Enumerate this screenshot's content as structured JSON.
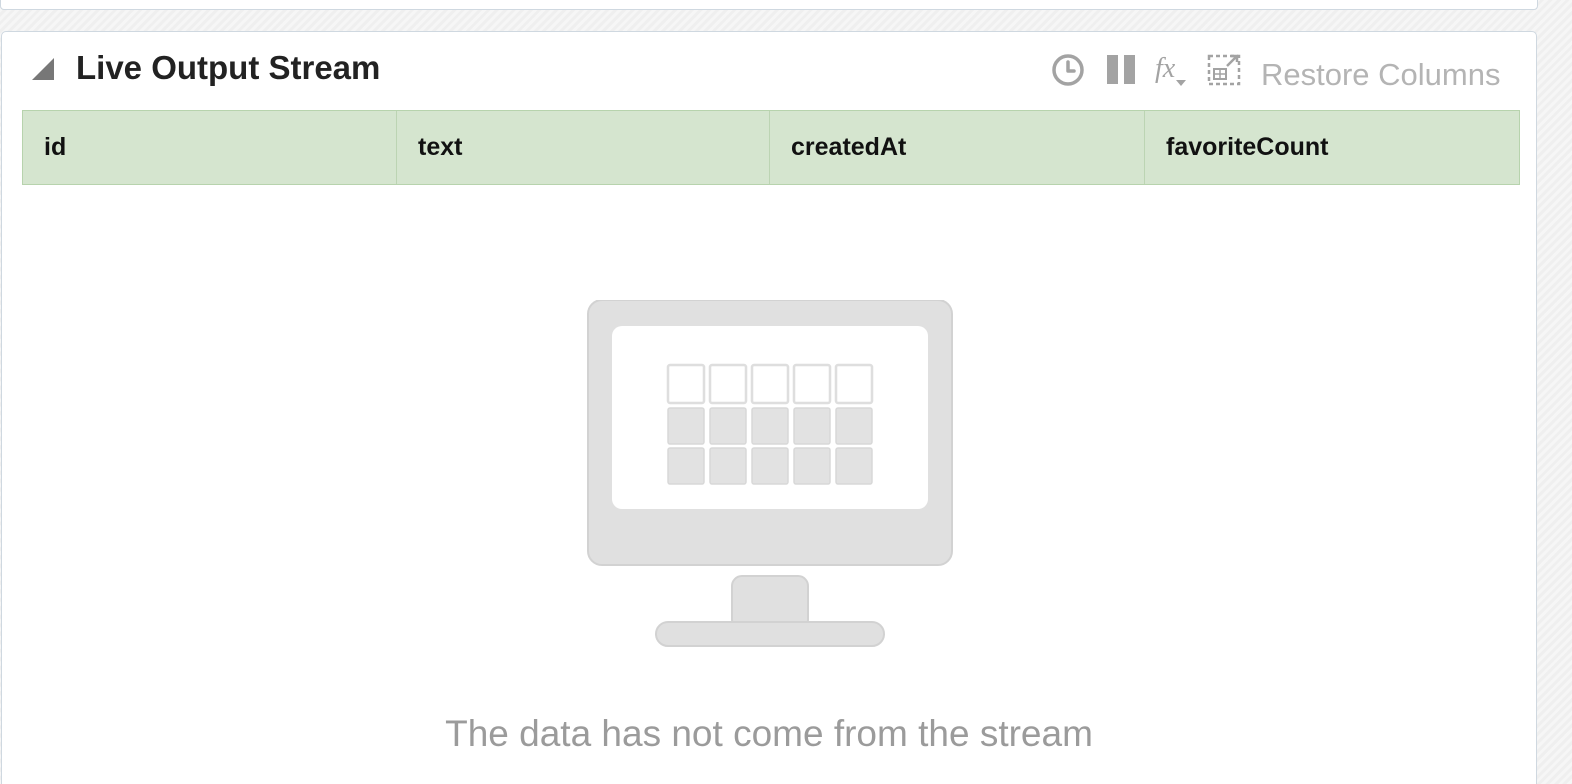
{
  "panel": {
    "title": "Live Output Stream",
    "toolbar": {
      "restore_columns_label": "Restore Columns",
      "icons": [
        "clock-icon",
        "pause-icon",
        "function-icon",
        "fit-columns-icon"
      ]
    }
  },
  "table": {
    "columns": [
      "id",
      "text",
      "createdAt",
      "favoriteCount"
    ]
  },
  "empty_state": {
    "message": "The data has not come from the stream",
    "icon": "monitor-icon"
  },
  "colors": {
    "header_bg": "#d5e5cf",
    "header_border": "#b7d3ad",
    "muted_text": "#9b9b9b",
    "illustration": "#e0e0e0"
  }
}
